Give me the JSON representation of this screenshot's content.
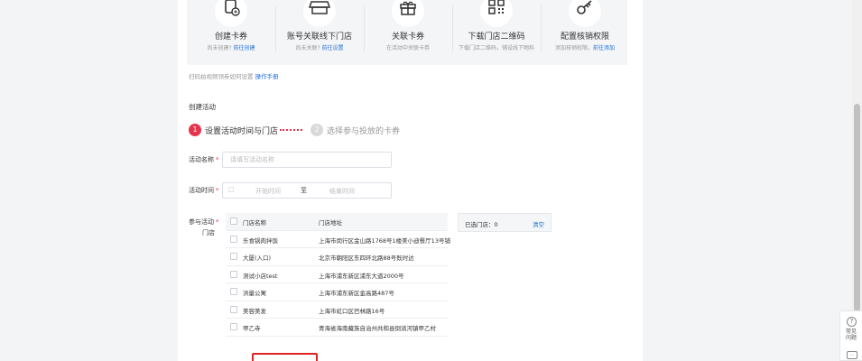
{
  "steps": [
    {
      "icon": "coupon-add-icon",
      "title": "创建卡券",
      "desc": "尚未创建?",
      "link": "前往创建"
    },
    {
      "icon": "store-icon",
      "title": "账号关联线下门店",
      "desc": "尚未关联?",
      "link": "前往设置"
    },
    {
      "icon": "gift-icon",
      "title": "关联卡券",
      "desc": "在活动中关联卡券",
      "link": ""
    },
    {
      "icon": "qrcode-icon",
      "title": "下载门店二维码",
      "desc": "下载门店二维码，铺设线下物料",
      "link": ""
    },
    {
      "icon": "key-icon",
      "title": "配置核销权限",
      "desc": "添加核销权限，",
      "link": "前往添加"
    }
  ],
  "note": {
    "text": "扫码拍视频领券如何设置",
    "link": "操作手册"
  },
  "section_title": "创建活动",
  "wizard": [
    {
      "num": "1",
      "label": "设置活动时间与门店"
    },
    {
      "num": "2",
      "label": "选择参与投放的卡券"
    }
  ],
  "form": {
    "name_label": "活动名称",
    "name_placeholder": "请填写活动名称",
    "time_label": "活动时间",
    "start_placeholder": "开始时间",
    "range_sep": "至",
    "end_placeholder": "结束时间",
    "store_label_1": "参与活动",
    "store_label_2": "门店",
    "required_mark": "*"
  },
  "table": {
    "headers": [
      "门店名称",
      "门店地址"
    ],
    "rows": [
      [
        "乐食锅肉拌饭",
        "上海市闵行区金山路1768号1楼美小迪餐厅13号铺"
      ],
      [
        "大厦(入口)",
        "北京市朝阳区东四环北路88号既时达"
      ],
      [
        "测试小店test",
        "上海市浦东新区浦东大道2000号"
      ],
      [
        "洪量公寓",
        "上海市浦东新区金高路487号"
      ],
      [
        "美容美发",
        "上海市虹口区巴林路16号"
      ],
      [
        "甲乙寺",
        "青海省海南藏族自治州共和县倒淌河镇甲乙村"
      ]
    ]
  },
  "selected": {
    "label": "已选门店：0",
    "clear": "清空"
  },
  "float_bar": {
    "help_glyph": "?",
    "text": "常见问题",
    "chat_glyph": "..."
  },
  "colors": {
    "primary": "#1e6fd9",
    "accent": "#e5344e",
    "highlight": "#e02424"
  }
}
